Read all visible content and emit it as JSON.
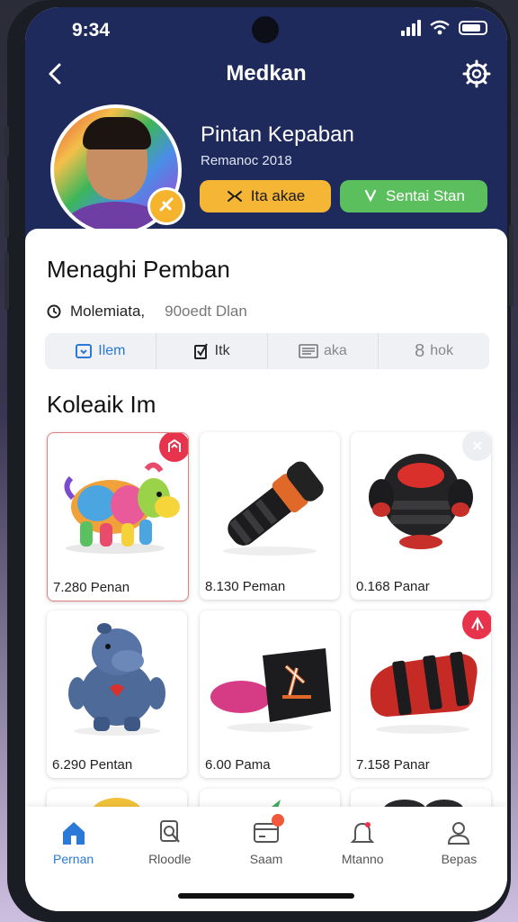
{
  "status": {
    "time": "9:34"
  },
  "nav": {
    "title": "Medkan"
  },
  "profile": {
    "name": "Pintan Kepaban",
    "subtitle": "Remanoc 2018",
    "btn_primary": "Ita akae",
    "btn_secondary": "Sentai Stan"
  },
  "section": {
    "title": "Menaghi Pemban",
    "meta_left": "Molemiata,",
    "meta_right": "90oedt Dlan"
  },
  "tabs": [
    {
      "label": "Ilem",
      "icon": "grid-icon"
    },
    {
      "label": "Itk",
      "icon": "check-icon"
    },
    {
      "label": "aka",
      "icon": "list-icon"
    },
    {
      "label": "hok",
      "icon": ""
    }
  ],
  "tab_number": "8",
  "collection": {
    "title": "Koleaik Im",
    "items": [
      {
        "caption": "7.280 Penan",
        "icon": "rainbow-horse-plush"
      },
      {
        "caption": "8.130 Peman",
        "icon": "black-orange-toy-blaster"
      },
      {
        "caption": "0.168 Panar",
        "icon": "black-red-robot-armor"
      },
      {
        "caption": "6.290 Pentan",
        "icon": "blue-hippo-plush"
      },
      {
        "caption": "6.00 Pama",
        "icon": "pink-black-glove"
      },
      {
        "caption": "7.158 Panar",
        "icon": "red-black-padded-bag"
      }
    ]
  },
  "tabbar": [
    {
      "label": "Pernan",
      "icon": "home-icon"
    },
    {
      "label": "Rloodle",
      "icon": "search-doc-icon"
    },
    {
      "label": "Saam",
      "icon": "card-icon"
    },
    {
      "label": "Mtanno",
      "icon": "bell-icon"
    },
    {
      "label": "Bepas",
      "icon": "person-icon"
    }
  ],
  "colors": {
    "header": "#1f2a5c",
    "accent": "#2a79d8",
    "yellow": "#f5b535",
    "green": "#5bbf5e",
    "badge": "#e8334d"
  }
}
